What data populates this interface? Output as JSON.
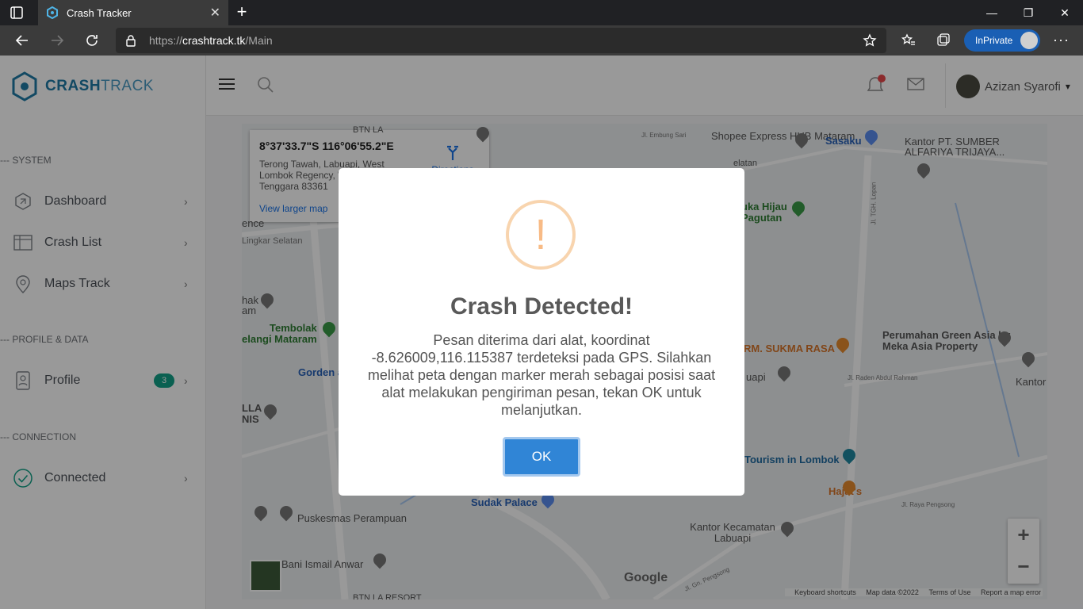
{
  "browser": {
    "tab_title": "Crash Tracker",
    "url_prefix": "https://",
    "url_host": "crashtrack.tk",
    "url_path": "/Main",
    "inprivate_label": "InPrivate"
  },
  "brand": {
    "part1": "CRASH",
    "part2": "TRACK"
  },
  "sidebar": {
    "section_system": "--- SYSTEM",
    "dashboard": "Dashboard",
    "crash_list": "Crash List",
    "maps_track": "Maps Track",
    "section_profile": "--- PROFILE & DATA",
    "profile": "Profile",
    "profile_badge": "3",
    "section_connection": "--- CONNECTION",
    "connected": "Connected"
  },
  "topbar": {
    "user_name": "Azizan Syarofi"
  },
  "map": {
    "info_coord": "8°37'33.7\"S 116°06'55.2\"E",
    "info_address": "Terong Tawah, Labuapi, West Lombok Regency, West Nusa Tenggara 83361",
    "info_directions": "Directions",
    "info_larger": "View larger map",
    "labels": {
      "shopee": "Shopee Express HUB Mataram",
      "sasaku": "Sasaku",
      "kantor_pt": "Kantor PT. SUMBER ALFARIYA TRIJAYA...",
      "suka_hijau": "uka Hijau Pagutan",
      "lingkar": "Lingkar Selatan",
      "tembolak": "Tembolak",
      "pelangi": "elangi Mataram",
      "gorden": "Gorden a",
      "perumahan": "Perumahan Green Asia by Meka Asia Property",
      "sukma": "RM. SUKMA RASA",
      "labuapi": "uapi",
      "kantor_r": "Kantor L",
      "tourism": "Tourism in Lombok",
      "hajat": "Hajat's",
      "sudak": "Sudak Palace",
      "puskesmas": "Puskesmas Perampuan",
      "kantor_kec": "Kantor Kecamatan Labuapi",
      "bani": "Bani Ismail Anwar",
      "btn": "BTN LA RESORT",
      "btn_top": "BTN LA",
      "hak": "hak am",
      "lla": "LLA NIS",
      "ence": "ence",
      "abdul": "Jl. Raden Abdul Rahman",
      "raya_pengsong": "Jl. Raya Pengsong",
      "gn_pengsong": "Jl. Gn. Pengsong",
      "embung": "Jl. Embung Sari",
      "lopan": "Jl. TGH. Lopan",
      "selatan": "elatan"
    },
    "attrib_keys": "Keyboard shortcuts",
    "attrib_data": "Map data ©2022",
    "attrib_terms": "Terms of Use",
    "attrib_report": "Report a map error",
    "google": "Google"
  },
  "modal": {
    "icon": "!",
    "title": "Crash Detected!",
    "text": "Pesan diterima dari alat, koordinat -8.626009,116.115387 terdeteksi pada GPS. Silahkan melihat peta dengan marker merah sebagai posisi saat alat melakukan pengiriman pesan, tekan OK untuk melanjutkan.",
    "ok": "OK"
  },
  "colors": {
    "accent": "#3085d6",
    "brand": "#1f7aa6",
    "badge": "#12a187",
    "warn": "#f8bb86"
  }
}
